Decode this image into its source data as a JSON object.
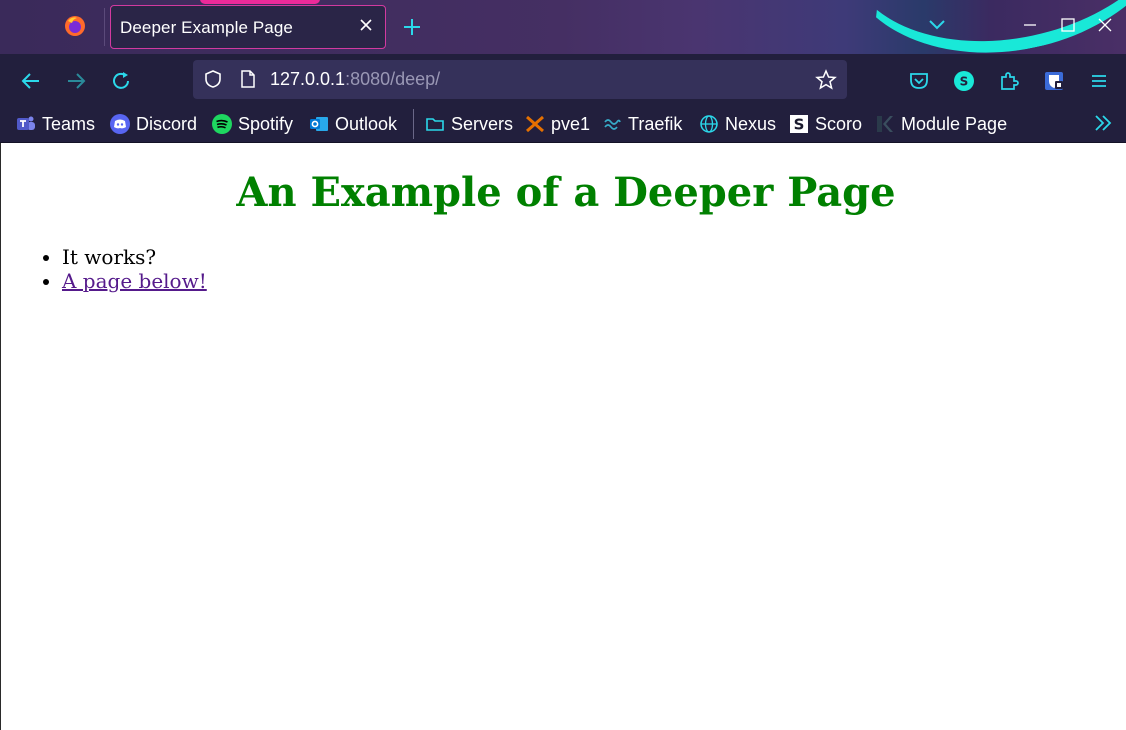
{
  "browser": {
    "tab": {
      "title": "Deeper Example Page"
    },
    "urlbar": {
      "host": "127.0.0.1",
      "rest": ":8080/deep/"
    },
    "bookmarks": [
      {
        "label": "Teams",
        "icon": "teams-icon"
      },
      {
        "label": "Discord",
        "icon": "discord-icon"
      },
      {
        "label": "Spotify",
        "icon": "spotify-icon"
      },
      {
        "label": "Outlook",
        "icon": "outlook-icon"
      },
      {
        "label": "Servers",
        "icon": "folder-icon"
      },
      {
        "label": "pve1",
        "icon": "proxmox-icon"
      },
      {
        "label": "Traefik",
        "icon": "traefik-icon"
      },
      {
        "label": "Nexus",
        "icon": "globe-icon"
      },
      {
        "label": "Scoro",
        "icon": "scoro-icon"
      },
      {
        "label": "Module Page",
        "icon": "module-icon"
      }
    ],
    "colors": {
      "accent": "#19e8d8",
      "tab_border": "#d23aa0",
      "toolbar": "#221f3d"
    }
  },
  "page": {
    "heading": "An Example of a Deeper Page",
    "items": [
      {
        "text": "It works?"
      },
      {
        "text": "A page below!",
        "is_link": true
      }
    ],
    "colors": {
      "heading": "#008000",
      "link": "#551a8b"
    }
  }
}
